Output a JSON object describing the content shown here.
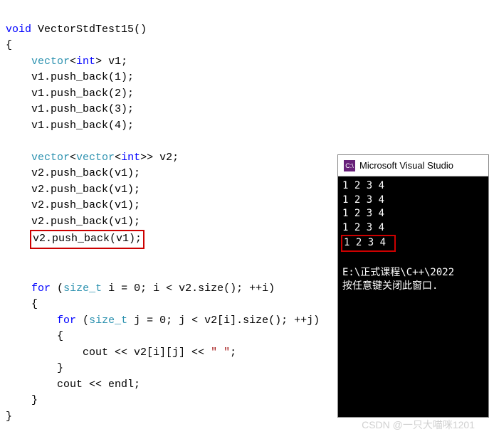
{
  "code": {
    "keywords": {
      "void": "void",
      "int": "int",
      "for": "for"
    },
    "types": {
      "vector": "vector",
      "size_t": "size_t"
    },
    "funcName": "VectorStdTest15",
    "v1decl": " v1;",
    "pb1": "v1.push_back(1);",
    "pb2": "v1.push_back(2);",
    "pb3": "v1.push_back(3);",
    "pb4": "v1.push_back(4);",
    "v2decl": " v2;",
    "pbv1": "v2.push_back(v1);",
    "outerFor1": " i = 0; i < v2.size(); ++i)",
    "innerFor1": " j = 0; j < v2[i].size(); ++j)",
    "coutLine1": "cout << v2[i][j] << ",
    "strSpace": "\" \"",
    "semi": ";",
    "coutEndl": "cout << endl;",
    "lbrace": "{",
    "rbrace": "}",
    "lparen": "(",
    "lt": "<",
    "gt": ">",
    "doubleGt": ">>",
    "funcParens": "()"
  },
  "console": {
    "title": "Microsoft Visual Studio",
    "rows": [
      "1 2 3 4",
      "1 2 3 4",
      "1 2 3 4",
      "1 2 3 4",
      "1 2 3 4"
    ],
    "path": "E:\\正式课程\\C++\\2022",
    "prompt": "按任意键关闭此窗口. "
  },
  "watermark": "CSDN @一只大喵咪1201"
}
